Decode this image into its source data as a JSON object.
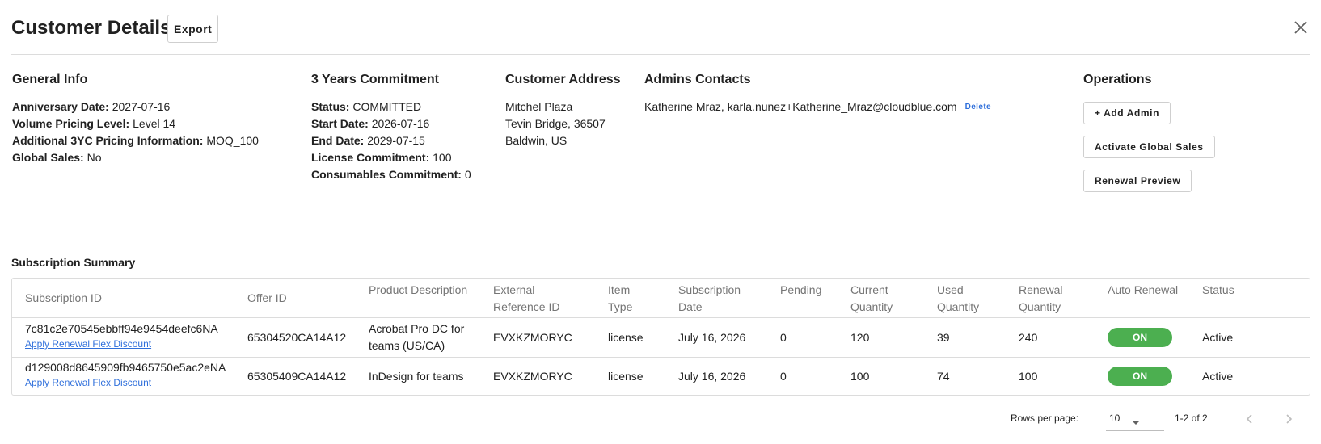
{
  "header": {
    "title": "Customer Details",
    "export_label": "Export",
    "close_icon": "close-icon"
  },
  "general_info": {
    "title": "General Info",
    "anniversary_label": "Anniversary Date:",
    "anniversary_value": "2027-07-16",
    "volume_label": "Volume Pricing Level:",
    "volume_value": "Level 14",
    "additional_label": "Additional 3YC Pricing Information:",
    "additional_value": "MOQ_100",
    "global_sales_label": "Global Sales:",
    "global_sales_value": "No"
  },
  "commitment": {
    "title": "3 Years Commitment",
    "status_label": "Status:",
    "status_value": "COMMITTED",
    "start_label": "Start Date:",
    "start_value": "2026-07-16",
    "end_label": "End Date:",
    "end_value": "2029-07-15",
    "license_label": "License Commitment:",
    "license_value": "100",
    "consumables_label": "Consumables Commitment:",
    "consumables_value": "0"
  },
  "address": {
    "title": "Customer Address",
    "line1": "Mitchel Plaza",
    "line2": "Tevin Bridge, 36507",
    "line3": "Baldwin, US"
  },
  "admins": {
    "title": "Admins Contacts",
    "contact": "Katherine Mraz, karla.nunez+Katherine_Mraz@cloudblue.com",
    "delete_label": "Delete"
  },
  "operations": {
    "title": "Operations",
    "add_admin": "+ Add Admin",
    "activate_global": "Activate Global Sales",
    "renewal_preview": "Renewal Preview"
  },
  "summary": {
    "title": "Subscription Summary",
    "headers": {
      "subscription_id": "Subscription ID",
      "offer_id": "Offer ID",
      "product_desc": "Product Description",
      "external_ref_1": "External",
      "external_ref_2": "Reference ID",
      "item_type_1": "Item",
      "item_type_2": "Type",
      "sub_date_1": "Subscription",
      "sub_date_2": "Date",
      "pending": "Pending",
      "current_qty_1": "Current",
      "current_qty_2": "Quantity",
      "used_qty_1": "Used",
      "used_qty_2": "Quantity",
      "renewal_qty_1": "Renewal",
      "renewal_qty_2": "Quantity",
      "auto_renewal": "Auto Renewal",
      "status": "Status"
    },
    "rows": [
      {
        "subscription_id": "7c81c2e70545ebbff94e9454deefc6NA",
        "flex_link": "Apply Renewal Flex Discount",
        "offer_id": "65304520CA14A12",
        "product_desc": "Acrobat Pro DC for teams (US/CA)",
        "external_ref": "EVXKZMORYC",
        "item_type": "license",
        "sub_date": "July 16, 2026",
        "pending": "0",
        "current_qty": "120",
        "used_qty": "39",
        "renewal_qty": "240",
        "auto_renewal": "ON",
        "status": "Active"
      },
      {
        "subscription_id": "d129008d8645909fb9465750e5ac2eNA",
        "flex_link": "Apply Renewal Flex Discount",
        "offer_id": "65305409CA14A12",
        "product_desc": "InDesign for teams",
        "external_ref": "EVXKZMORYC",
        "item_type": "license",
        "sub_date": "July 16, 2026",
        "pending": "0",
        "current_qty": "100",
        "used_qty": "74",
        "renewal_qty": "100",
        "auto_renewal": "ON",
        "status": "Active"
      }
    ]
  },
  "pagination": {
    "rows_per_page_label": "Rows per page:",
    "rows_per_page_value": "10",
    "range": "1-2 of 2"
  },
  "colors": {
    "accent_link": "#2f6fdb",
    "toggle_on": "#4caf50"
  }
}
